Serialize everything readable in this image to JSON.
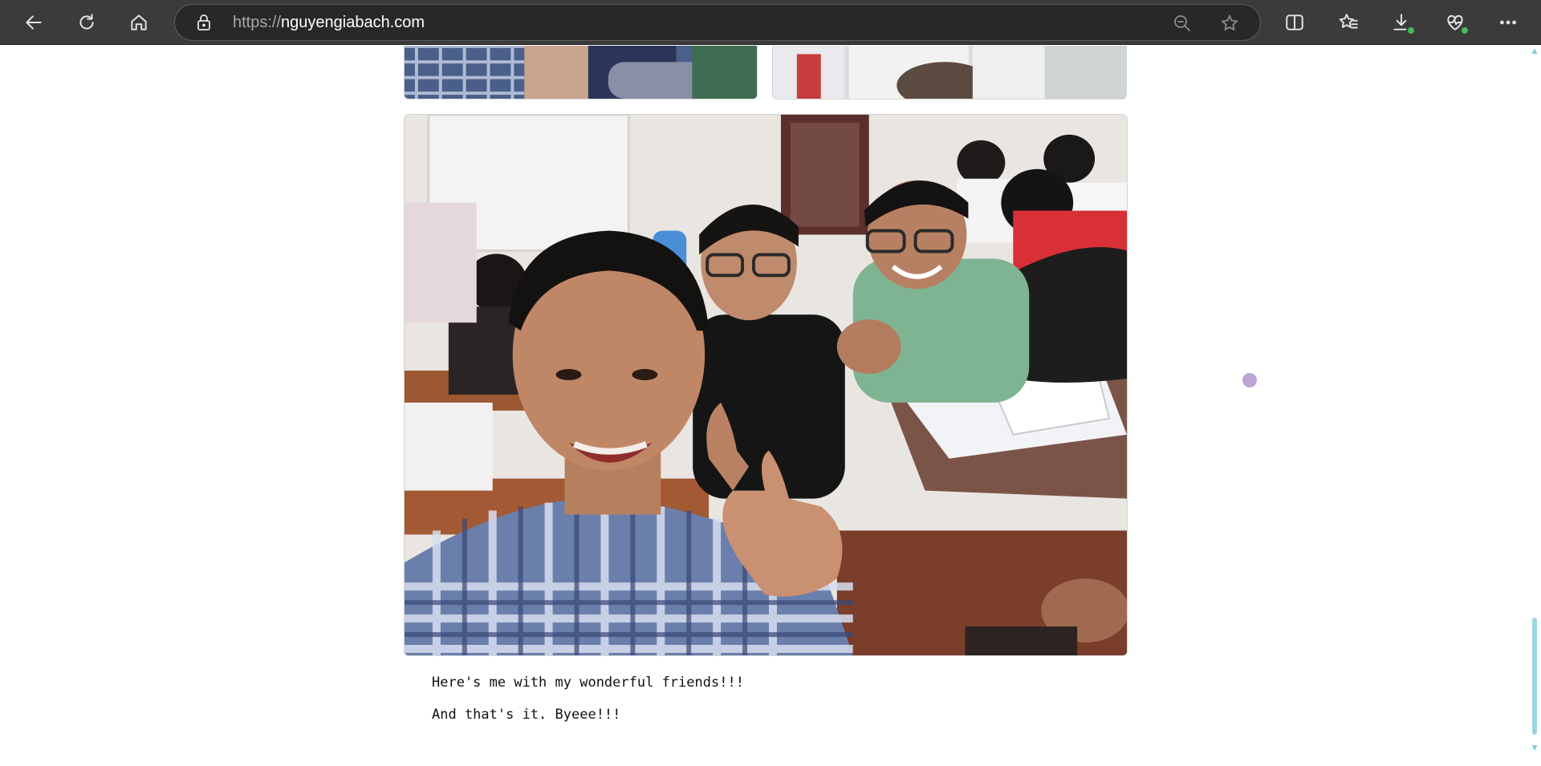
{
  "browser": {
    "url_scheme": "https://",
    "url_host": "nguyengiabach.com",
    "icons": {
      "back": "back-arrow-icon",
      "refresh": "refresh-icon",
      "home": "home-icon",
      "lock": "lock-icon",
      "zoom": "zoom-out-icon",
      "favorite": "star-icon",
      "split": "split-screen-icon",
      "favorites": "favorites-icon",
      "downloads": "download-icon",
      "health": "browser-essentials-icon",
      "more": "more-icon"
    }
  },
  "page": {
    "captions": {
      "friends": "Here's me with my wonderful friends!!!",
      "outro": "And that's it. Byeee!!!"
    },
    "photos": {
      "top_left": "classmates-photo-partial",
      "top_right": "classmates-photo-partial",
      "main": "selfie-with-friends-photo"
    }
  },
  "colors": {
    "toolbar": "#3b3b3b",
    "omnibox": "#282828",
    "scroll_accent": "#9bd7de",
    "cursor_dot": "#bba4d6"
  }
}
